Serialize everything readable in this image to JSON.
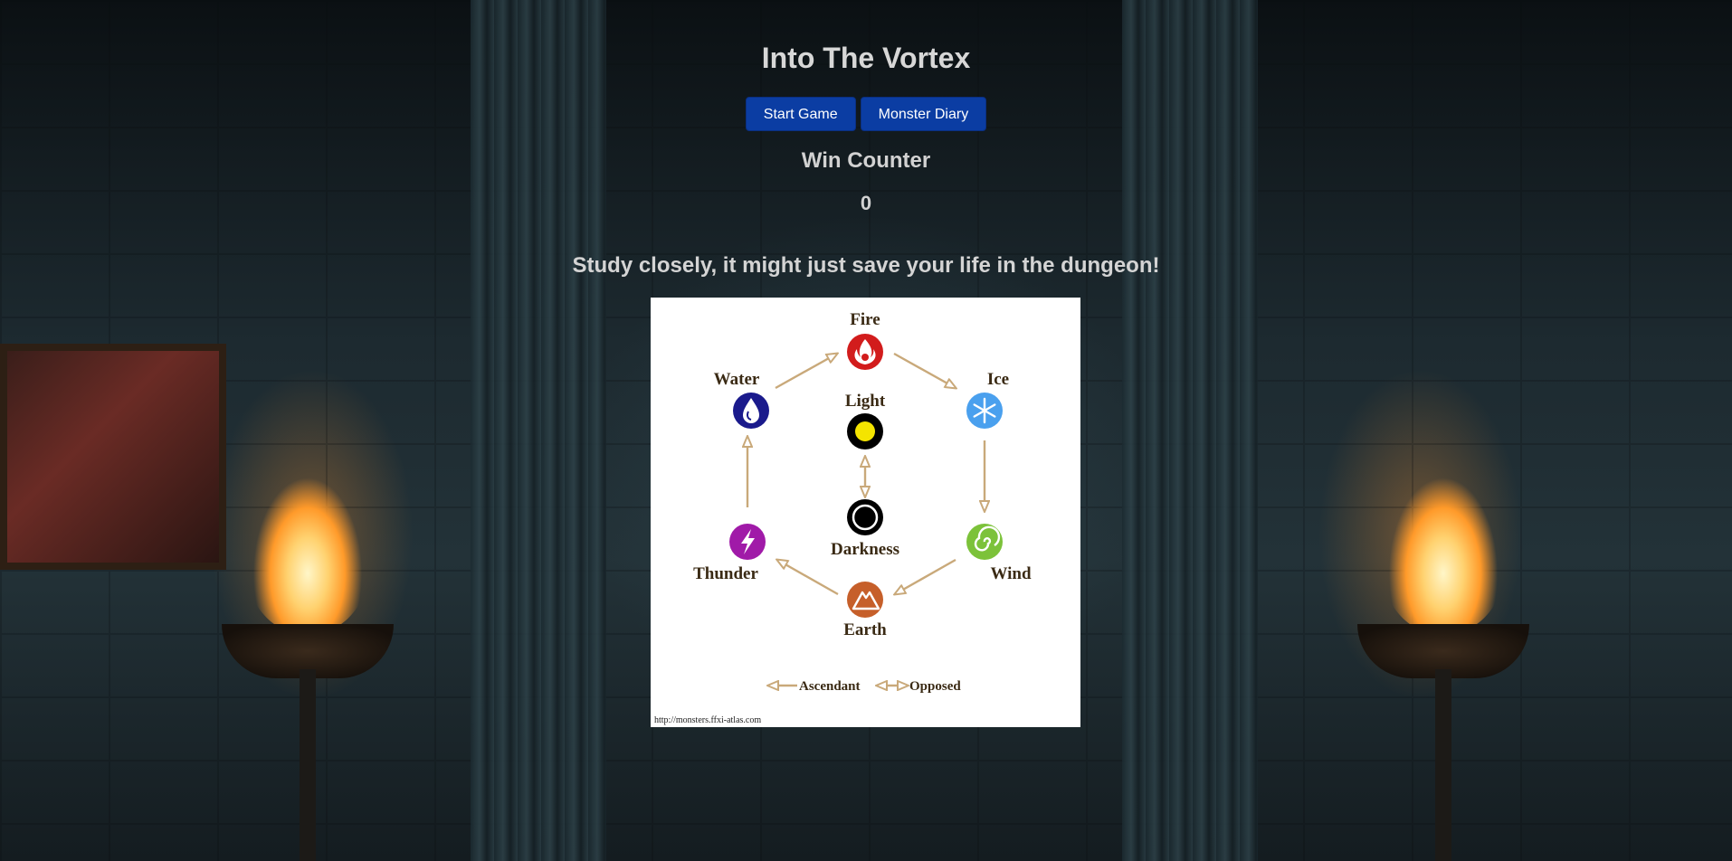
{
  "page": {
    "title": "Into The Vortex",
    "buttons": {
      "start": "Start Game",
      "diary": "Monster Diary"
    },
    "win_counter": {
      "label": "Win Counter",
      "value": "0"
    },
    "hint": "Study closely, it might just save your life in the dungeon!"
  },
  "element_chart": {
    "elements": {
      "fire": {
        "label": "Fire",
        "color": "#d21c1c",
        "icon": "flame-icon"
      },
      "ice": {
        "label": "Ice",
        "color": "#4aa0ee",
        "icon": "snowflake-icon"
      },
      "wind": {
        "label": "Wind",
        "color": "#7cc23a",
        "icon": "swirl-icon"
      },
      "earth": {
        "label": "Earth",
        "color": "#c65f2a",
        "icon": "mountain-icon"
      },
      "thunder": {
        "label": "Thunder",
        "color": "#a01aa8",
        "icon": "lightning-icon"
      },
      "water": {
        "label": "Water",
        "color": "#1a1a8c",
        "icon": "droplet-icon"
      },
      "light": {
        "label": "Light",
        "color": "#f4e400",
        "icon": "light-orb-icon"
      },
      "darkness": {
        "label": "Darkness",
        "color": "#000000",
        "icon": "dark-orb-icon"
      }
    },
    "legend": {
      "ascendant": "Ascendant",
      "opposed": "Opposed"
    },
    "source": "http://monsters.ffxi-atlas.com"
  },
  "colors": {
    "button_bg": "#0b3da3",
    "arrow": "#c9a97a"
  }
}
